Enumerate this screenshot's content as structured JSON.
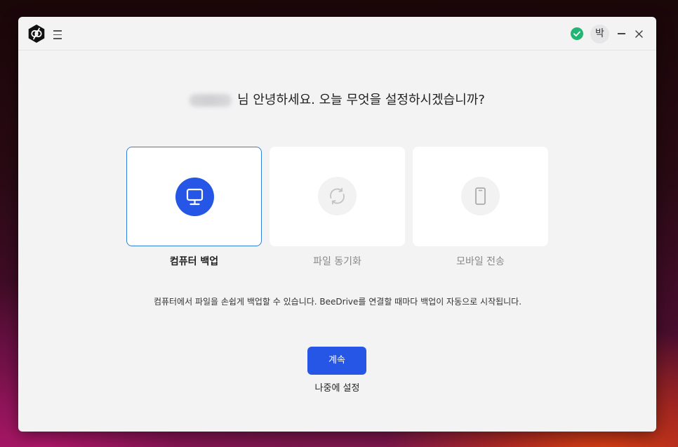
{
  "titlebar": {
    "logo_icon": "beedrive-logo-icon",
    "menu_icon": "hamburger-menu-icon",
    "status_icon": "check-circle-icon",
    "status_color": "#22b573",
    "avatar_text": "박",
    "minimize_icon": "minimize-icon",
    "close_icon": "close-icon"
  },
  "greeting": {
    "text": "님 안녕하세요. 오늘 무엇을 설정하시겠습니까?"
  },
  "options": [
    {
      "label": "컴퓨터 백업",
      "icon": "monitor-icon",
      "selected": true,
      "color": "#2556e6"
    },
    {
      "label": "파일 동기화",
      "icon": "sync-icon",
      "selected": false
    },
    {
      "label": "모바일 전송",
      "icon": "mobile-phone-icon",
      "selected": false
    }
  ],
  "description": "컴퓨터에서 파일을 손쉽게 백업할 수 있습니다. BeeDrive를 연결할 때마다 백업이 자동으로 시작됩니다.",
  "buttons": {
    "continue_label": "계속",
    "later_label": "나중에 설정"
  },
  "colors": {
    "accent": "#2556e6",
    "selected_border": "#2f7fdd"
  }
}
